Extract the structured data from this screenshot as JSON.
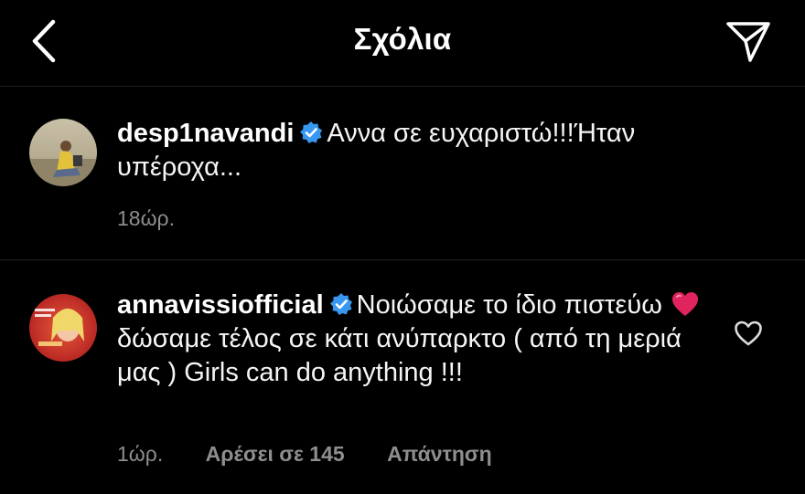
{
  "header": {
    "title": "Σχόλια",
    "back_icon": "chevron-left-icon",
    "share_icon": "paper-plane-icon"
  },
  "comments": [
    {
      "username": "desp1navandi",
      "verified": true,
      "text": "Αννα σε ευχαριστώ!!!Ήταν υπέροχα...",
      "time": "18ώρ."
    },
    {
      "username": "annavissiofficial",
      "verified": true,
      "text_before_emoji": "Νοιώσαμε το ίδιο πιστεύω",
      "emoji": "red-heart",
      "text_after_emoji": "δώσαμε τέλος σε κάτι ανύπαρκτο ( από τη μεριά μας )  Girls can do anything !!!",
      "time": "1ώρ.",
      "likes_label": "Αρέσει σε 145",
      "reply_label": "Απάντηση"
    }
  ],
  "colors": {
    "background": "#000000",
    "text": "#ffffff",
    "meta": "#8e8e8e",
    "verified_badge": "#3897f0",
    "heart": "#e0245e"
  }
}
